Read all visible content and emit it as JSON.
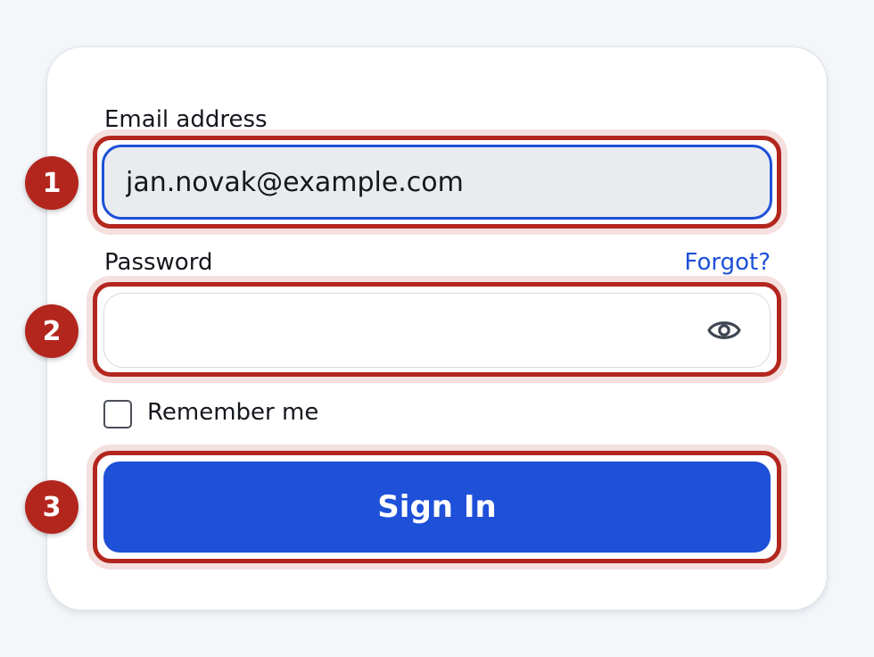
{
  "form": {
    "email_label": "Email address",
    "email_value": "jan.novak@example.com",
    "password_label": "Password",
    "password_value": "",
    "forgot_link": "Forgot?",
    "remember_label": "Remember me",
    "remember_checked": false,
    "submit_label": "Sign In"
  },
  "annotations": {
    "markers": [
      "1",
      "2",
      "3"
    ]
  },
  "icons": {
    "password_toggle": "eye-icon",
    "checkbox": "checkbox-unchecked"
  },
  "colors": {
    "accent": "#1e50d8",
    "annotation": "#b3261e",
    "page_background": "#f4f6fa",
    "input_filled_background": "#e9ebef"
  }
}
